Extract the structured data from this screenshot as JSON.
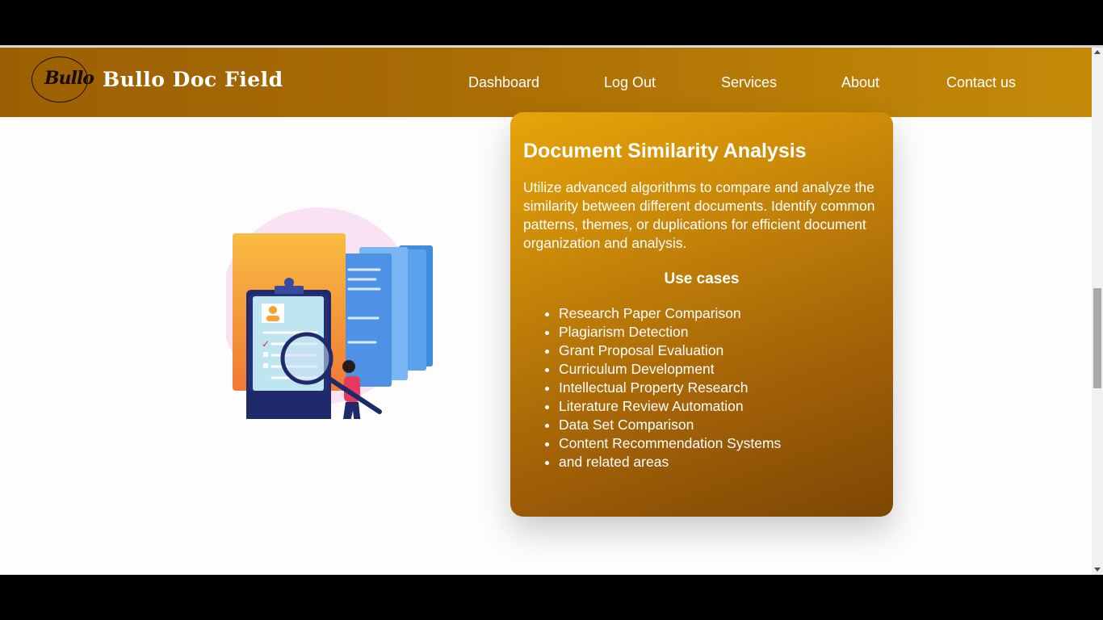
{
  "brand": {
    "logo_text": "Bullo",
    "name": "Bullo Doc Field"
  },
  "nav": {
    "items": [
      {
        "label": "Dashboard"
      },
      {
        "label": "Log Out"
      },
      {
        "label": "Services"
      },
      {
        "label": "About"
      },
      {
        "label": "Contact us"
      }
    ]
  },
  "card": {
    "title": "Document Similarity Analysis",
    "description": "Utilize advanced algorithms to compare and analyze the similarity between different documents. Identify common patterns, themes, or duplications for efficient document organization and analysis.",
    "use_cases_title": "Use cases",
    "use_cases": [
      "Research Paper Comparison",
      "Plagiarism Detection",
      "Grant Proposal Evaluation",
      "Curriculum Development",
      "Intellectual Property Research",
      "Literature Review Automation",
      "Data Set Comparison",
      "Content Recommendation Systems",
      "and related areas"
    ]
  },
  "colors": {
    "navbar_start": "#9c5f03",
    "navbar_end": "#c48a08",
    "card_top": "#e8a409",
    "card_bottom": "#7d4604"
  },
  "illustration": "document-analysis-illustration"
}
